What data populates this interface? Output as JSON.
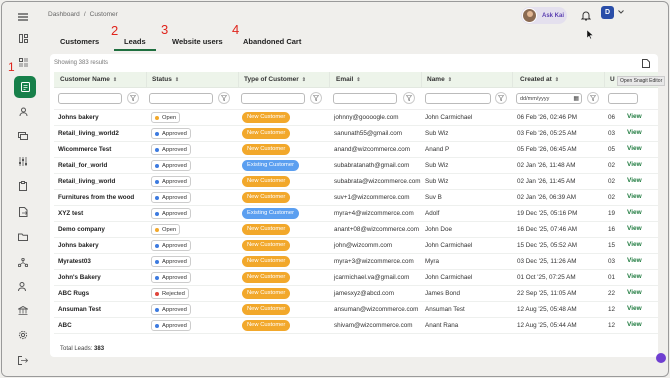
{
  "breadcrumb": {
    "root": "Dashboard",
    "sep": "/",
    "current": "Customer"
  },
  "header": {
    "ask_label": "Ask Kai",
    "user_initial": "D"
  },
  "tabs": [
    {
      "label": "Customers"
    },
    {
      "label": "Leads",
      "active": true
    },
    {
      "label": "Website users"
    },
    {
      "label": "Abandoned Cart"
    }
  ],
  "annotations": {
    "n1": "1",
    "n2": "2",
    "n3": "3",
    "n4": "4"
  },
  "table": {
    "showing": "Showing 383 results",
    "tooltip": "Open Snagit Editor",
    "columns": {
      "customer_name": "Customer Name",
      "status": "Status",
      "type": "Type of Customer",
      "email": "Email",
      "name": "Name",
      "created": "Created at",
      "updated": "U"
    },
    "date_placeholder": "dd/mm/yyyy",
    "rows": [
      {
        "customer": "Johns bakery",
        "status": "Open",
        "type": "New Customer",
        "email": "johnny@goooogle.com",
        "name": "John Carmichael",
        "created": "06 Feb '26, 02:46 PM",
        "updated": "06",
        "action": "View"
      },
      {
        "customer": "Retail_living_world2",
        "status": "Approved",
        "type": "New Customer",
        "email": "sanunath55@gmail.com",
        "name": "Sub Wiz",
        "created": "03 Feb '26, 05:25 AM",
        "updated": "03",
        "action": "View"
      },
      {
        "customer": "Wicommerce Test",
        "status": "Approved",
        "type": "New Customer",
        "email": "anand@wizcommerce.com",
        "name": "Anand P",
        "created": "05 Feb '26, 06:45 AM",
        "updated": "05",
        "action": "View"
      },
      {
        "customer": "Retail_for_world",
        "status": "Approved",
        "type": "Existing Customer",
        "email": "subabratanath@gmail.com",
        "name": "Sub Wiz",
        "created": "02 Jan '26, 11:48 AM",
        "updated": "02",
        "action": "View"
      },
      {
        "customer": "Retail_living_world",
        "status": "Approved",
        "type": "New Customer",
        "email": "subabrata@wizcommerce.com",
        "name": "Sub Wiz",
        "created": "02 Jan '26, 11:45 AM",
        "updated": "02",
        "action": "View"
      },
      {
        "customer": "Furnitures from the wood",
        "status": "Approved",
        "type": "New Customer",
        "email": "suv+1@wizcommerce.com",
        "name": "Suv B",
        "created": "02 Jan '26, 06:39 AM",
        "updated": "02",
        "action": "View"
      },
      {
        "customer": "XYZ test",
        "status": "Approved",
        "type": "Existing Customer",
        "email": "myra+4@wizcommerce.com",
        "name": "Adolf",
        "created": "19 Dec '25, 05:16 PM",
        "updated": "19",
        "action": "View"
      },
      {
        "customer": "Demo company",
        "status": "Open",
        "type": "New Customer",
        "email": "anant+08@wizcommerce.com",
        "name": "John Doe",
        "created": "16 Dec '25, 07:46 AM",
        "updated": "16",
        "action": "View"
      },
      {
        "customer": "Johns bakery",
        "status": "Approved",
        "type": "New Customer",
        "email": "john@wizcomm.com",
        "name": "John Carmichael",
        "created": "15 Dec '25, 05:52 AM",
        "updated": "15",
        "action": "View"
      },
      {
        "customer": "Myratest03",
        "status": "Approved",
        "type": "New Customer",
        "email": "myra+3@wizcommerce.com",
        "name": "Myra",
        "created": "03 Dec '25, 11:26 AM",
        "updated": "03",
        "action": "View"
      },
      {
        "customer": "John's Bakery",
        "status": "Approved",
        "type": "New Customer",
        "email": "jcarmichael.va@gmail.com",
        "name": "John Carmichael",
        "created": "01 Oct '25, 07:25 AM",
        "updated": "01",
        "action": "View"
      },
      {
        "customer": "ABC Rugs",
        "status": "Rejected",
        "type": "New Customer",
        "email": "jamesxyz@abcd.com",
        "name": "James Bond",
        "created": "22 Sep '25, 11:05 AM",
        "updated": "22",
        "action": "View"
      },
      {
        "customer": "Ansuman Test",
        "status": "Approved",
        "type": "New Customer",
        "email": "ansuman@wizcommerce.com",
        "name": "Ansuman Test",
        "created": "12 Aug '25, 05:48 AM",
        "updated": "12",
        "action": "View"
      },
      {
        "customer": "ABC",
        "status": "Approved",
        "type": "New Customer",
        "email": "shivam@wizcommerce.com",
        "name": "Anant Rana",
        "created": "12 Aug '25, 05:44 AM",
        "updated": "12",
        "action": "View"
      }
    ],
    "footer_label": "Total Leads:",
    "footer_count": "383"
  },
  "colors": {
    "accent": "#17804a",
    "new_customer": "#f2a82b",
    "existing_customer": "#5b9ff0",
    "open_dot": "#f2a82b",
    "approved_dot": "#3d7be0",
    "rejected_dot": "#e0443a"
  }
}
